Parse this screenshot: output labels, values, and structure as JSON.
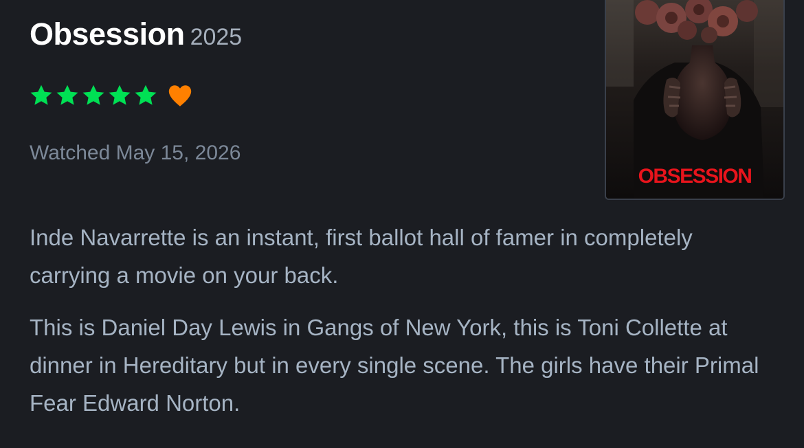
{
  "review": {
    "title": "Obsession",
    "year": "2025",
    "rating_stars": 5,
    "liked": true,
    "watched": "Watched May 15, 2026",
    "poster_text": "OBSESSION",
    "paragraphs": [
      "Inde Navarrette is an instant, first ballot hall of famer in completely carrying a movie on your back.",
      "This is Daniel Day Lewis in Gangs of New York, this is Toni Collette at dinner in Hereditary but in every single scene. The girls have their Primal Fear Edward Norton."
    ]
  },
  "colors": {
    "background": "#1b1d22",
    "star": "#00e054",
    "heart": "#ff8000",
    "title": "#ffffff",
    "muted": "#7c8898",
    "body": "#a6b4c4",
    "poster_title": "#e8141c"
  },
  "icons": {
    "star": "star-icon",
    "heart": "heart-icon"
  }
}
